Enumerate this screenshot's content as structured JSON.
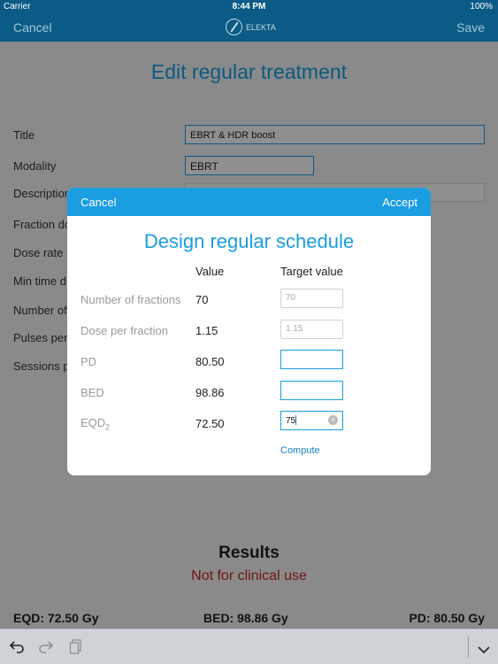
{
  "status": {
    "carrier": "Carrier",
    "time": "8:44 PM",
    "battery": "100%"
  },
  "nav": {
    "cancel": "Cancel",
    "save": "Save",
    "logo": "ELEKTA"
  },
  "page": {
    "title": "Edit regular treatment",
    "fields": {
      "title_label": "Title",
      "title_value": "EBRT & HDR boost",
      "modality_label": "Modality",
      "modality_value": "EBRT",
      "description_label": "Description",
      "fraction_label": "Fraction do",
      "dose_rate_label": "Dose rate [",
      "min_time_label": "Min time d",
      "number_label": "Number of",
      "pulses_label": "Pulses per",
      "sessions_label": "Sessions p"
    }
  },
  "results": {
    "title": "Results",
    "warning": "Not for clinical use",
    "eqd": "EQD: 72.50 Gy",
    "bed": "BED: 98.86 Gy",
    "pd": "PD: 80.50 Gy"
  },
  "keyboard": {
    "undo": "undo-icon",
    "redo": "redo-icon",
    "paste": "paste-icon",
    "dismiss": "chevron-down-icon"
  },
  "modal": {
    "cancel": "Cancel",
    "accept": "Accept",
    "title": "Design regular schedule",
    "col_value": "Value",
    "col_target": "Target value",
    "rows": [
      {
        "label": "Number of fractions",
        "value": "70",
        "target_placeholder": "70",
        "target_value": ""
      },
      {
        "label": "Dose per fraction",
        "value": "1.15",
        "target_placeholder": "1.15",
        "target_value": ""
      },
      {
        "label": "PD",
        "value": "80.50",
        "target_placeholder": "",
        "target_value": ""
      },
      {
        "label": "BED",
        "value": "98.86",
        "target_placeholder": "",
        "target_value": ""
      },
      {
        "label": "EQD",
        "label_sub": "2",
        "value": "72.50",
        "target_placeholder": "",
        "target_value": "75"
      }
    ],
    "compute": "Compute"
  },
  "colors": {
    "nav": "#0b5b86",
    "accent": "#1a9de1",
    "warning": "#6e1414"
  }
}
